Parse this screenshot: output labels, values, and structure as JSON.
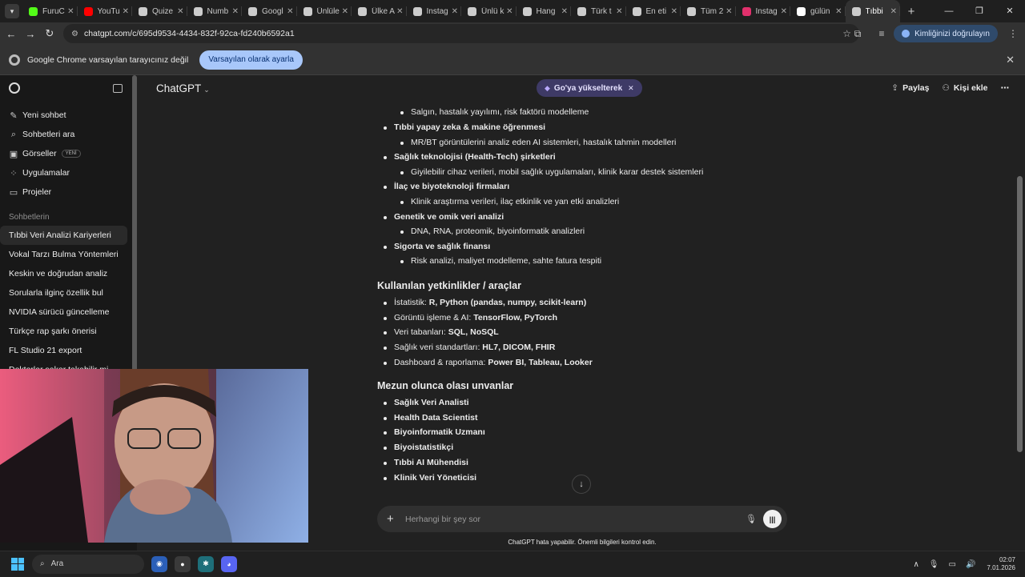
{
  "browser": {
    "tabs": [
      {
        "label": "FuruC",
        "icon": "kick-icon",
        "color": "#53fc18"
      },
      {
        "label": "YouTu",
        "icon": "youtube-icon",
        "color": "#ff0000"
      },
      {
        "label": "Quize",
        "icon": "chatgpt-icon",
        "color": "#cccccc"
      },
      {
        "label": "Numb",
        "icon": "chatgpt-icon",
        "color": "#cccccc"
      },
      {
        "label": "Googl",
        "icon": "chatgpt-icon",
        "color": "#cccccc"
      },
      {
        "label": "Ünlüle",
        "icon": "chatgpt-icon",
        "color": "#cccccc"
      },
      {
        "label": "Ülke A",
        "icon": "chatgpt-icon",
        "color": "#cccccc"
      },
      {
        "label": "Instag",
        "icon": "chatgpt-icon",
        "color": "#cccccc"
      },
      {
        "label": "Ünlü k",
        "icon": "chatgpt-icon",
        "color": "#cccccc"
      },
      {
        "label": "Hang",
        "icon": "chatgpt-icon",
        "color": "#cccccc"
      },
      {
        "label": "Türk t",
        "icon": "chatgpt-icon",
        "color": "#cccccc"
      },
      {
        "label": "En eti",
        "icon": "chatgpt-icon",
        "color": "#cccccc"
      },
      {
        "label": "Tüm 2",
        "icon": "chatgpt-icon",
        "color": "#cccccc"
      },
      {
        "label": "Instag",
        "icon": "instagram-icon",
        "color": "#e1306c"
      },
      {
        "label": "gülün",
        "icon": "google-icon",
        "color": "#ffffff"
      },
      {
        "label": "Tıbbi",
        "icon": "chatgpt-icon",
        "color": "#cccccc",
        "active": true
      }
    ],
    "url": "chatgpt.com/c/695d9534-4434-832f-92ca-fd240b6592a1",
    "profile_label": "Kimliğinizi doğrulayın",
    "infobar": {
      "message": "Google Chrome varsayılan tarayıcınız değil",
      "button": "Varsayılan olarak ayarla"
    }
  },
  "sidebar": {
    "actions": [
      {
        "label": "Yeni sohbet",
        "icon": "edit-icon"
      },
      {
        "label": "Sohbetleri ara",
        "icon": "search-icon"
      },
      {
        "label": "Görseller",
        "icon": "image-icon",
        "badge": "YENİ"
      },
      {
        "label": "Uygulamalar",
        "icon": "apps-icon"
      },
      {
        "label": "Projeler",
        "icon": "folder-icon"
      }
    ],
    "section_title": "Sohbetlerin",
    "chats": [
      "Tıbbi Veri Analizi Kariyerleri",
      "Vokal Tarzı Bulma Yöntemleri",
      "Keskin ve doğrudan analiz",
      "Sorularla ilginç özellik bul",
      "NVIDIA sürücü güncelleme",
      "Türkçe rap şarkı önerisi",
      "FL Studio 21 export",
      "Doktorlar saker takabilir mi"
    ]
  },
  "header": {
    "model": "ChatGPT",
    "upgrade": "Go'ya yükselterek",
    "share": "Paylaş",
    "add_person": "Kişi ekle"
  },
  "content": {
    "areas": [
      {
        "title": "Tıbbi yapay zeka & makine öğrenmesi",
        "detail": "MR/BT görüntülerini analiz eden AI sistemleri, hastalık tahmin modelleri"
      },
      {
        "title": "Sağlık teknolojisi (Health-Tech) şirketleri",
        "detail": "Giyilebilir cihaz verileri, mobil sağlık uygulamaları, klinik karar destek sistemleri"
      },
      {
        "title": "İlaç ve biyoteknoloji firmaları",
        "detail": "Klinik araştırma verileri, ilaç etkinlik ve yan etki analizleri"
      },
      {
        "title": "Genetik ve omik veri analizi",
        "detail": "DNA, RNA, proteomik, biyoinformatik analizleri"
      },
      {
        "title": "Sigorta ve sağlık finansı",
        "detail": "Risk analizi, maliyet modelleme, sahte fatura tespiti"
      }
    ],
    "top_detail": "Salgın, hastalık yayılımı, risk faktörü modelleme",
    "skills_heading": "Kullanılan yetkinlikler / araçlar",
    "skills": [
      {
        "label": "İstatistik: ",
        "value": "R, Python (pandas, numpy, scikit-learn)"
      },
      {
        "label": "Görüntü işleme & AI: ",
        "value": "TensorFlow, PyTorch"
      },
      {
        "label": "Veri tabanları: ",
        "value": "SQL, NoSQL"
      },
      {
        "label": "Sağlık veri standartları: ",
        "value": "HL7, DICOM, FHIR"
      },
      {
        "label": "Dashboard & raporlama: ",
        "value": "Power BI, Tableau, Looker"
      }
    ],
    "titles_heading": "Mezun olunca olası unvanlar",
    "titles": [
      "Sağlık Veri Analisti",
      "Health Data Scientist",
      "Biyoinformatik Uzmanı",
      "Biyoistatistikçi",
      "Tıbbi AI Mühendisi",
      "Klinik Veri Yöneticisi"
    ]
  },
  "composer": {
    "placeholder": "Herhangi bir şey sor",
    "disclaimer": "ChatGPT hata yapabilir. Önemli bilgileri kontrol edin."
  },
  "taskbar": {
    "search": "Ara",
    "time": "02:07",
    "date": "7.01.2026"
  }
}
